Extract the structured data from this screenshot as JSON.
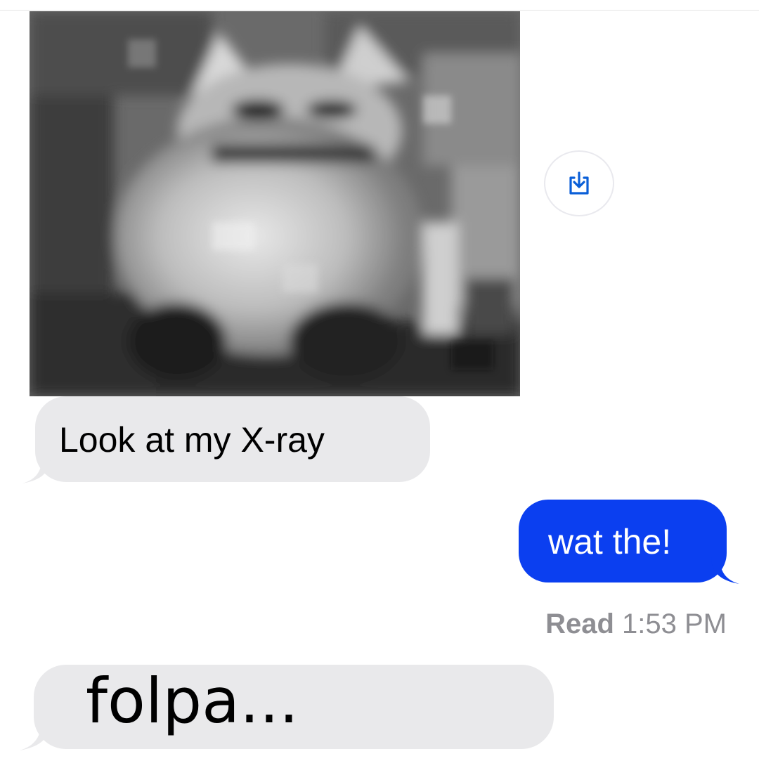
{
  "conversation": {
    "attachment": {
      "type": "photo",
      "subject": "blurry grayscale cat-like image",
      "save_icon": "save-download-icon"
    },
    "messages": [
      {
        "direction": "received",
        "text": "Look at my X-ray"
      },
      {
        "direction": "sent",
        "text": "wat the!"
      },
      {
        "direction": "received",
        "text": "folpa..."
      }
    ],
    "read_receipt": {
      "label": "Read",
      "time": "1:53 PM"
    }
  },
  "colors": {
    "sent_bubble": "#0b3ff0",
    "received_bubble": "#e9e9eb",
    "receipt_text": "#8e8e93",
    "icon_blue": "#0a5fd8"
  }
}
